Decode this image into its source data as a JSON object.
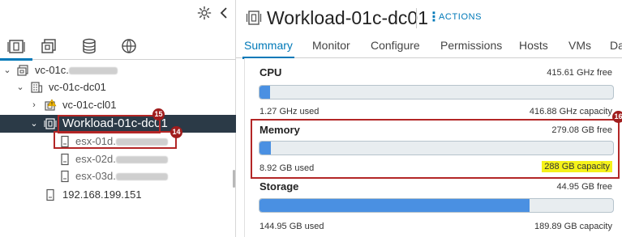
{
  "navigator": {
    "tab_icons": [
      "hosts-and-clusters-icon",
      "vms-and-templates-icon",
      "storage-icon",
      "networking-icon"
    ],
    "tree": [
      {
        "label": "vc-01c.",
        "blurred_suffix": "corp.internal",
        "icon": "vcenter-icon",
        "expanded": true
      },
      {
        "label": "vc-01c-dc01",
        "icon": "datacenter-icon",
        "expanded": true
      },
      {
        "label": "vc-01c-cl01",
        "icon": "cluster-warning-icon",
        "expanded": false
      },
      {
        "label": "Workload-01c-dc01",
        "icon": "resource-pool-icon",
        "expanded": true,
        "selected": true
      },
      {
        "label": "esx-01d.",
        "blurred_suffix": "corp.internal",
        "icon": "host-icon"
      },
      {
        "label": "esx-02d.",
        "blurred_suffix": "corp.internal",
        "icon": "host-icon"
      },
      {
        "label": "esx-03d.",
        "blurred_suffix": "corp.internal",
        "icon": "host-icon"
      },
      {
        "label": "192.168.199.151",
        "icon": "host-icon"
      }
    ],
    "annotations": {
      "selected_badge": "15",
      "host_badge": "14"
    }
  },
  "header": {
    "title": "Workload-01c-dc01",
    "actions_label": "ACTIONS"
  },
  "tabs": [
    "Summary",
    "Monitor",
    "Configure",
    "Permissions",
    "Hosts",
    "VMs",
    "Da"
  ],
  "active_tab": "Summary",
  "resources": {
    "cpu": {
      "name": "CPU",
      "free": "415.61 GHz free",
      "used": "1.27 GHz used",
      "capacity": "416.88 GHz capacity",
      "fill_fraction": 0.003
    },
    "memory": {
      "name": "Memory",
      "free": "279.08 GB free",
      "used": "8.92 GB used",
      "capacity": "288 GB capacity",
      "fill_fraction": 0.031,
      "badge": "16"
    },
    "storage": {
      "name": "Storage",
      "free": "44.95 GB free",
      "used": "144.95 GB used",
      "capacity": "189.89 GB capacity",
      "fill_fraction": 0.763
    }
  },
  "colors": {
    "accent": "#0079b8",
    "selected_bg": "#2b3a47",
    "bar_fill": "#4a90e2",
    "annotation_red": "#b32626",
    "capacity_highlight": "#f5f21a"
  }
}
